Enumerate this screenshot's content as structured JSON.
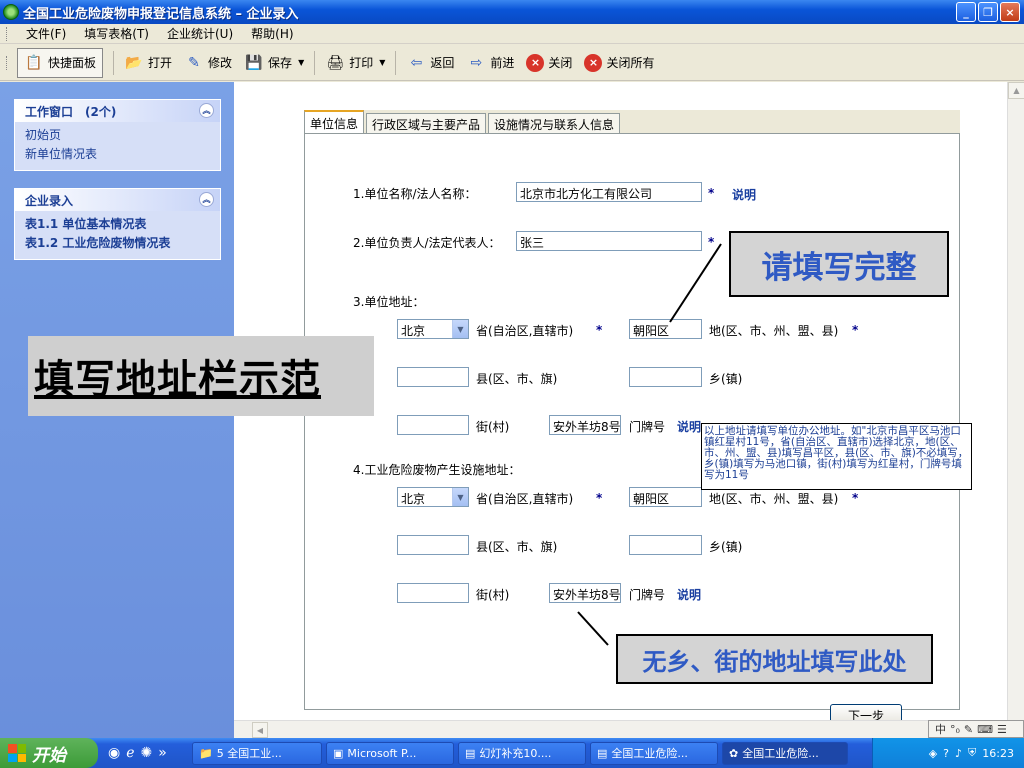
{
  "window": {
    "title": "全国工业危险废物申报登记信息系统 – 企业录入",
    "minimize": "_",
    "restore": "❐",
    "close": "×"
  },
  "menu": [
    "文件(F)",
    "填写表格(T)",
    "企业统计(U)",
    "帮助(H)"
  ],
  "toolbar": {
    "quick_panel": "快捷面板",
    "open": "打开",
    "edit": "修改",
    "save": "保存",
    "print": "打印",
    "back": "返回",
    "forward": "前进",
    "close": "关闭",
    "close_all": "关闭所有"
  },
  "sidebar": {
    "work_window": {
      "title": "工作窗口",
      "count": "(2个)",
      "items": [
        "初始页",
        "新单位情况表"
      ]
    },
    "enterprise_entry": {
      "title": "企业录入",
      "items": [
        "表1.1 单位基本情况表",
        "表1.2 工业危险废物情况表"
      ]
    }
  },
  "tabs": [
    "单位信息",
    "行政区域与主要产品",
    "设施情况与联系人信息"
  ],
  "form": {
    "q1_label": "1.单位名称/法人名称：",
    "q1_value": "北京市北方化工有限公司",
    "q2_label": "2.单位负责人/法定代表人：",
    "q2_value": "张三",
    "q3_label": "3.单位地址：",
    "q4_label": "4.工业危险废物产生设施地址：",
    "star": "*",
    "explain": "说明",
    "province_suffix": "省(自治区,直辖市)",
    "city_suffix": "地(区、市、州、盟、县)",
    "county_suffix": "县(区、市、旗)",
    "township_suffix": "乡(镇)",
    "street_suffix": "街(村)",
    "house_suffix": "门牌号",
    "addr1": {
      "province": "北京",
      "city": "朝阳区",
      "county": "",
      "township": "",
      "street": "",
      "house": "安外羊坊8号"
    },
    "addr2": {
      "province": "北京",
      "city": "朝阳区",
      "county": "",
      "township": "",
      "street": "",
      "house": "安外羊坊8号"
    },
    "next_button": "下一步"
  },
  "tooltip": "以上地址请填写单位办公地址。如\"北京市昌平区马池口镇红星村11号，省(自治区、直辖市)选择北京，地(区、市、州、盟、县)填写昌平区，县(区、市、旗)不必填写，乡(镇)填写为马池口镇，街(村)填写为红星村，门牌号填写为11号",
  "annotations": {
    "left": "填写地址栏示范",
    "top_right": "请填写完整",
    "bottom_right": "无乡、街的地址填写此处"
  },
  "taskbar": {
    "start": "开始",
    "tasks": [
      "5 全国工业...",
      "Microsoft P...",
      "幻灯补充10....",
      "全国工业危险...",
      "全国工业危险..."
    ],
    "time": "16:23"
  },
  "colors": {
    "accent": "#1c3f95",
    "callout_text": "#2f5ac4"
  }
}
